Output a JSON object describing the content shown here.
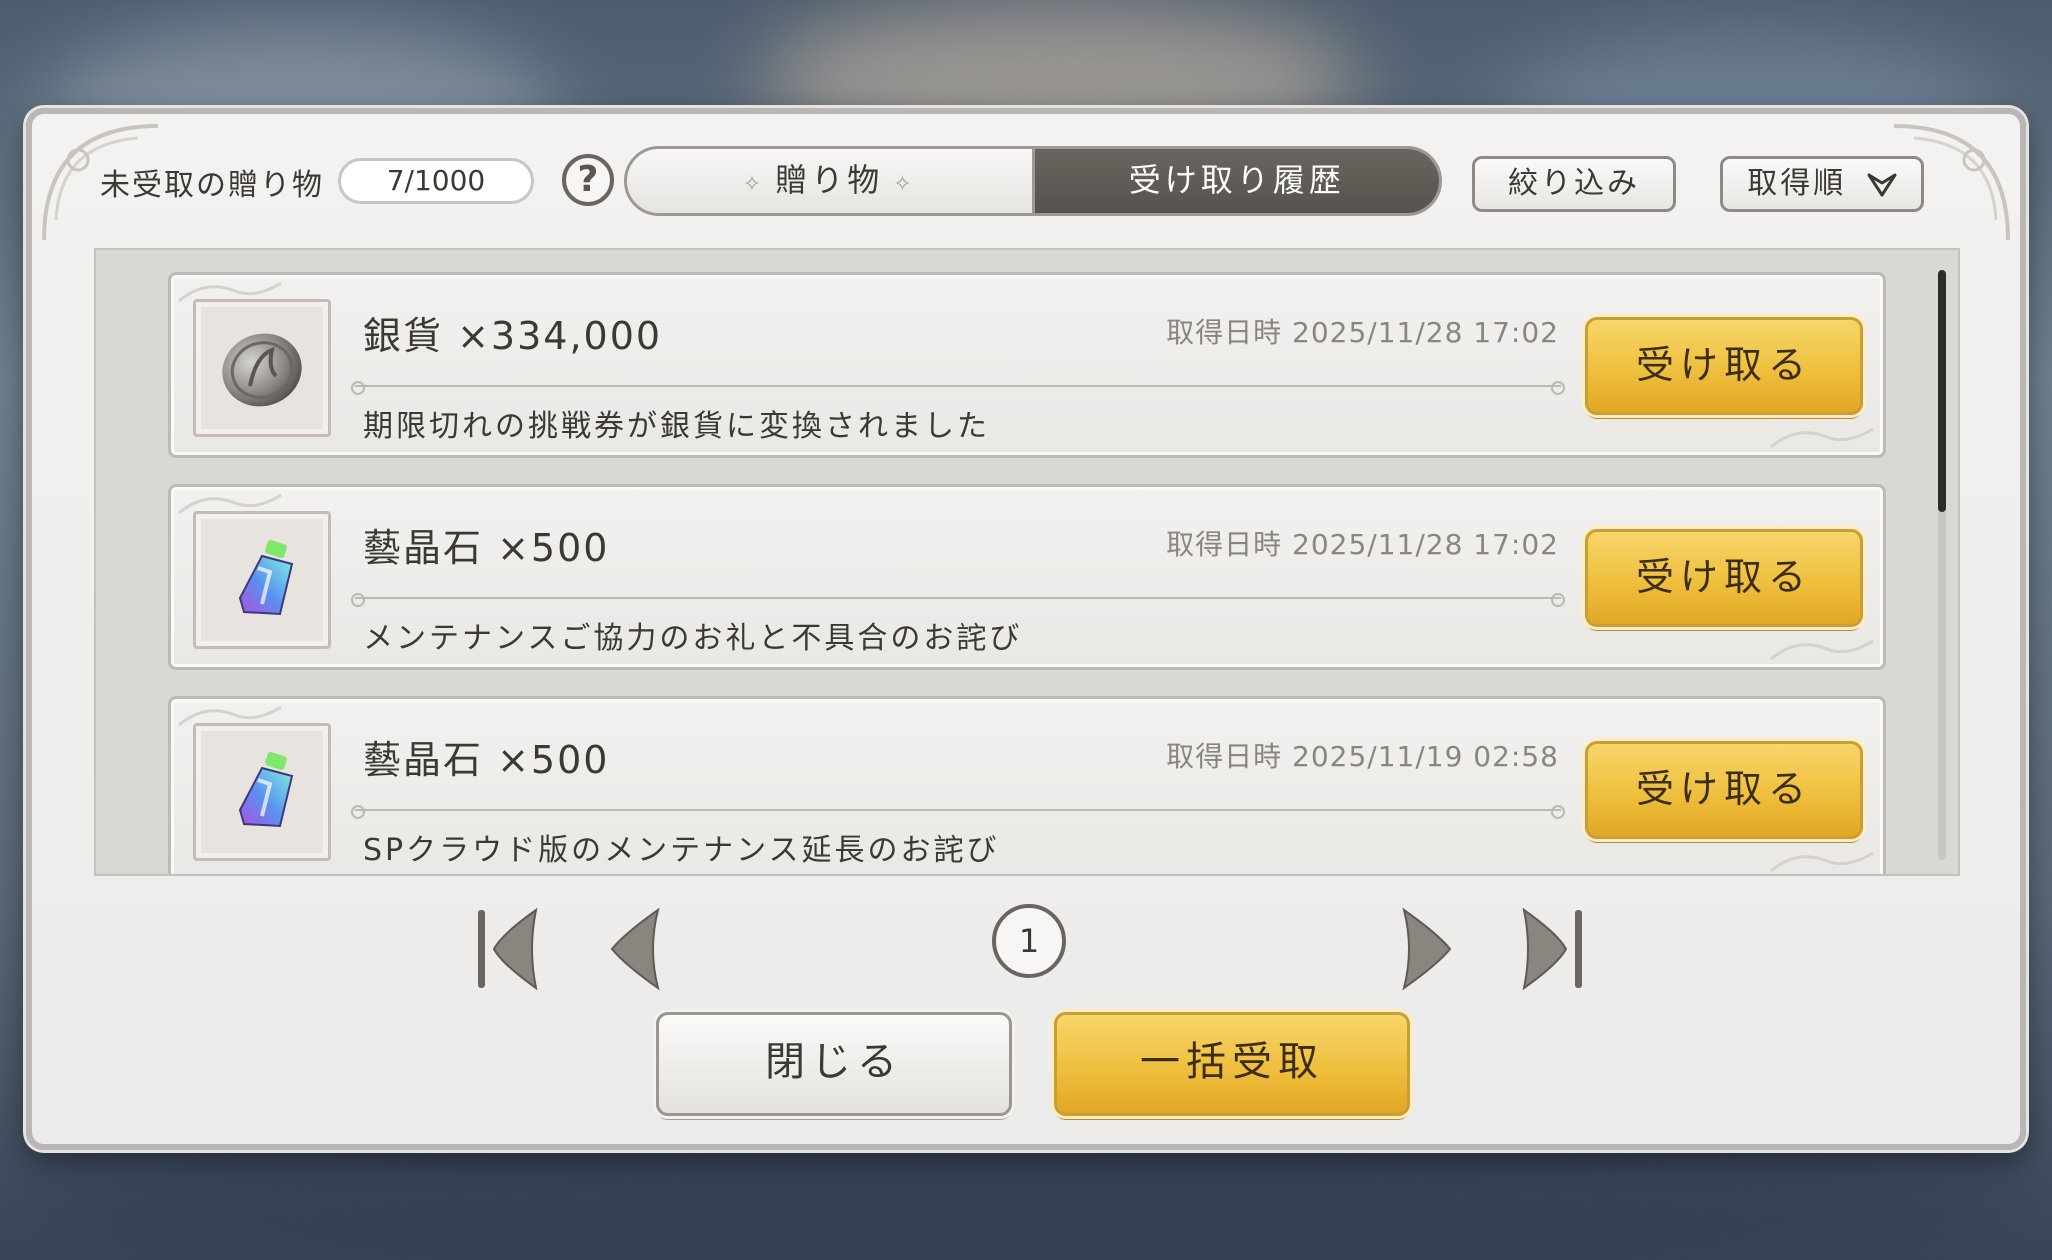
{
  "header": {
    "label": "未受取の贈り物",
    "counter": "7/1000",
    "help_symbol": "?"
  },
  "tabs": [
    {
      "label": "贈り物",
      "state": "inactive"
    },
    {
      "label": "受け取り履歴",
      "state": "active"
    }
  ],
  "tools": {
    "filter_label": "絞り込み",
    "sort_label": "取得順",
    "sort_icon": "sort-arrow-icon"
  },
  "gifts": [
    {
      "icon": "silver-coin-icon",
      "name": "銀貨 ×334,000",
      "date": "取得日時 2025/11/28 17:02",
      "description": "期限切れの挑戦券が銀貨に変換されました",
      "button": "受け取る"
    },
    {
      "icon": "crystal-bottle-icon",
      "name": "藝晶石 ×500",
      "date": "取得日時 2025/11/28 17:02",
      "description": "メンテナンスご協力のお礼と不具合のお詫び",
      "button": "受け取る"
    },
    {
      "icon": "crystal-bottle-icon",
      "name": "藝晶石 ×500",
      "date": "取得日時 2025/11/19 02:58",
      "description": "SPクラウド版のメンテナンス延長のお詫び",
      "button": "受け取る"
    }
  ],
  "pagination": {
    "current_page": "1"
  },
  "footer": {
    "close_label": "閉じる",
    "bulk_label": "一括受取"
  },
  "colors": {
    "accent_gold": "#efbf3d",
    "active_tab": "#5f5a55",
    "panel": "#ecebe9"
  }
}
